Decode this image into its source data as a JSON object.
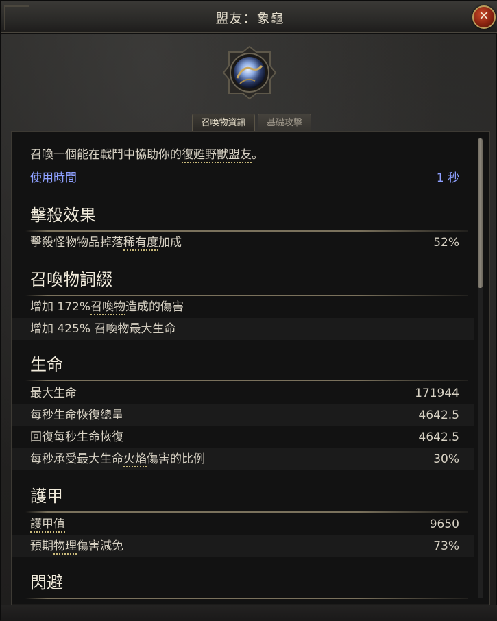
{
  "window": {
    "title": "盟友：象龜"
  },
  "tabs": [
    {
      "label": "召喚物資訊",
      "active": true
    },
    {
      "label": "基礎攻擊",
      "active": false
    }
  ],
  "description": {
    "pre": "召喚一個能在戰鬥中協助你的",
    "link": "復甦野獸盟友",
    "post": "。"
  },
  "duration": {
    "label": "使用時間",
    "value": "1 秒"
  },
  "sections": {
    "kill": {
      "heading": "擊殺效果",
      "rows": [
        {
          "pre": "擊殺怪物物品掉落",
          "link": "稀有度",
          "post": "加成",
          "value": "52%"
        }
      ]
    },
    "affix": {
      "heading": "召喚物詞綴",
      "rows": [
        {
          "pre": "增加 172%",
          "link": "召喚物",
          "post": "造成的傷害"
        },
        {
          "text": "增加 425% 召喚物最大生命"
        }
      ]
    },
    "life": {
      "heading": "生命",
      "rows": [
        {
          "label": "最大生命",
          "value": "171944"
        },
        {
          "label": "每秒生命恢復總量",
          "value": "4642.5"
        },
        {
          "label": "回復每秒生命恢復",
          "value": "4642.5"
        },
        {
          "pre": "每秒承受最大生命",
          "link": "火焰",
          "post": "傷害的比例",
          "value": "30%"
        }
      ]
    },
    "armor": {
      "heading": "護甲",
      "rows": [
        {
          "link": "護甲值",
          "value": "9650"
        },
        {
          "pre": "預期",
          "link": "物理",
          "post": "傷害減免",
          "value": "73%"
        }
      ]
    },
    "evasion": {
      "heading": "閃避"
    }
  },
  "icons": {
    "close": "close-icon",
    "emblem": "summon-orb-icon"
  },
  "colors": {
    "accent_blue": "#8ea0ff",
    "link_underline": "#c9b97a",
    "close_red": "#b23a1c"
  }
}
